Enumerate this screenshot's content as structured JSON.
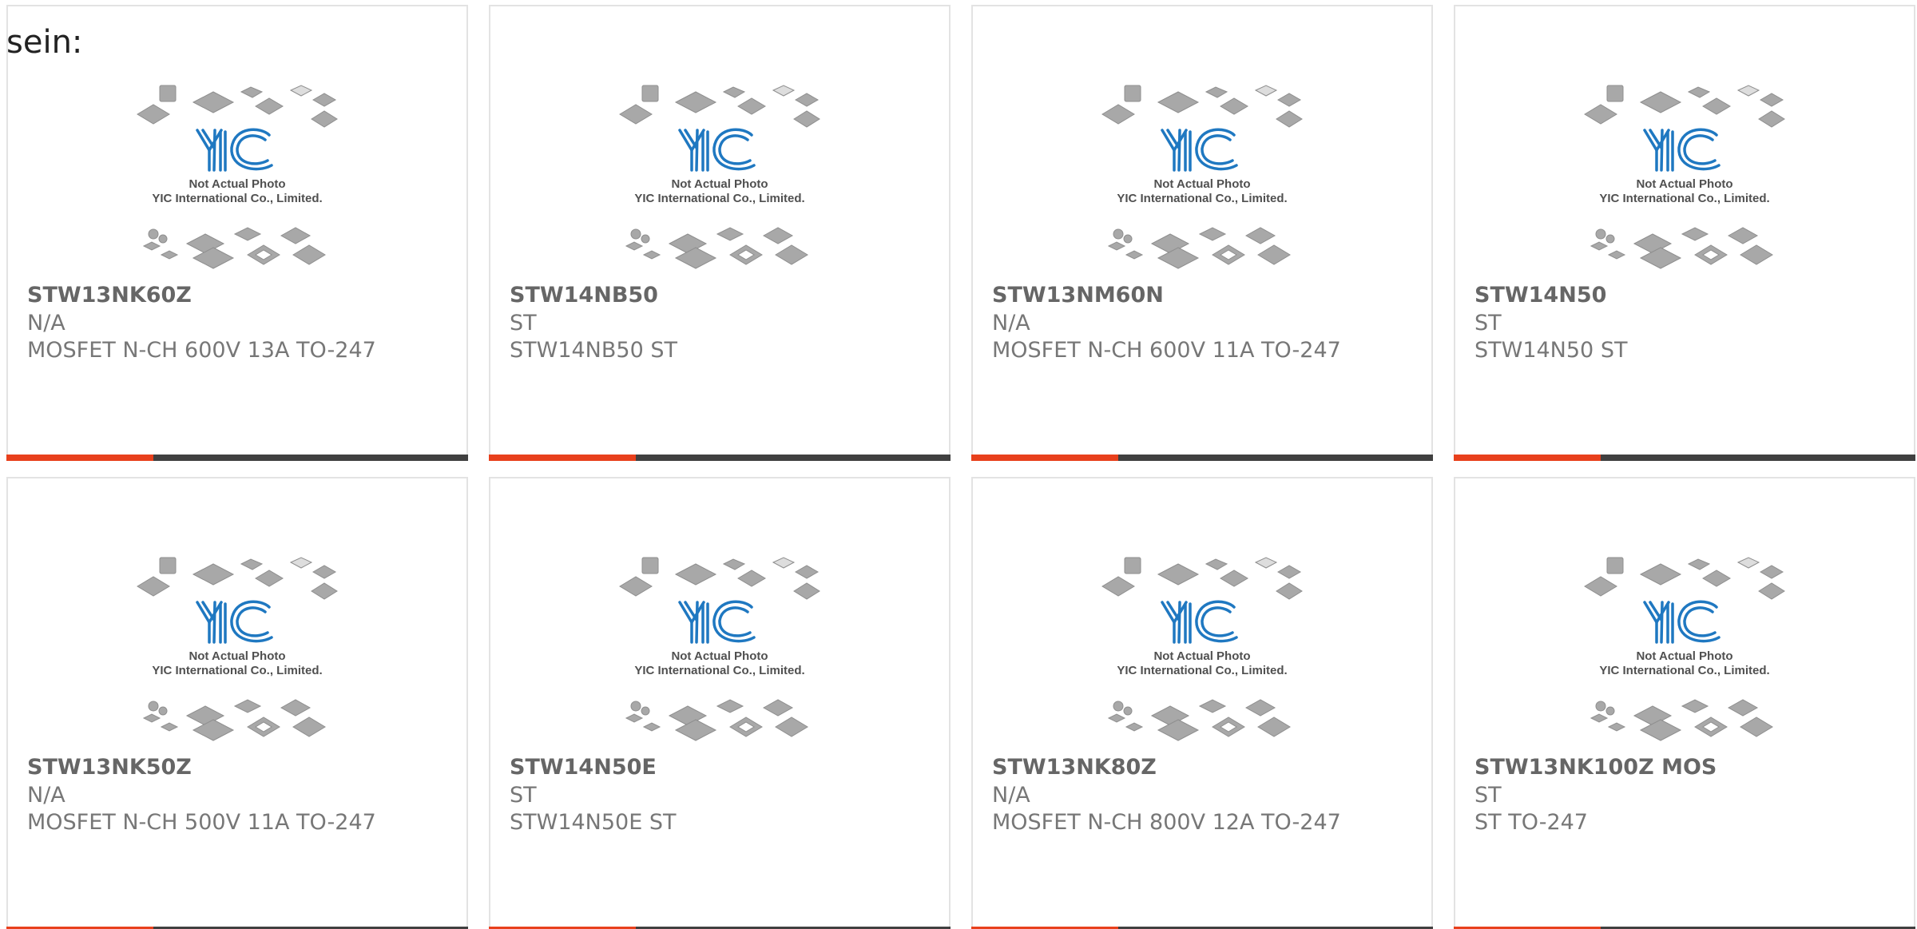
{
  "intro": "sein:",
  "placeholder_image": {
    "line1": "Not Actual Photo",
    "line2": "YIC International Co., Limited."
  },
  "colors": {
    "accent": "#e8401c",
    "bar": "#404040",
    "logo": "#1f78c1"
  },
  "products": [
    {
      "part": "STW13NK60Z",
      "maker": "N/A",
      "desc": "MOSFET N-CH 600V 13A TO-247"
    },
    {
      "part": "STW14NB50",
      "maker": "ST",
      "desc": "STW14NB50 ST"
    },
    {
      "part": "STW13NM60N",
      "maker": "N/A",
      "desc": "MOSFET N-CH 600V 11A TO-247"
    },
    {
      "part": "STW14N50",
      "maker": "ST",
      "desc": "STW14N50 ST"
    },
    {
      "part": "STW13NK50Z",
      "maker": "N/A",
      "desc": "MOSFET N-CH 500V 11A TO-247"
    },
    {
      "part": "STW14N50E",
      "maker": "ST",
      "desc": "STW14N50E ST"
    },
    {
      "part": "STW13NK80Z",
      "maker": "N/A",
      "desc": "MOSFET N-CH 800V 12A TO-247"
    },
    {
      "part": "STW13NK100Z MOS",
      "maker": "ST",
      "desc": "ST TO-247"
    }
  ]
}
